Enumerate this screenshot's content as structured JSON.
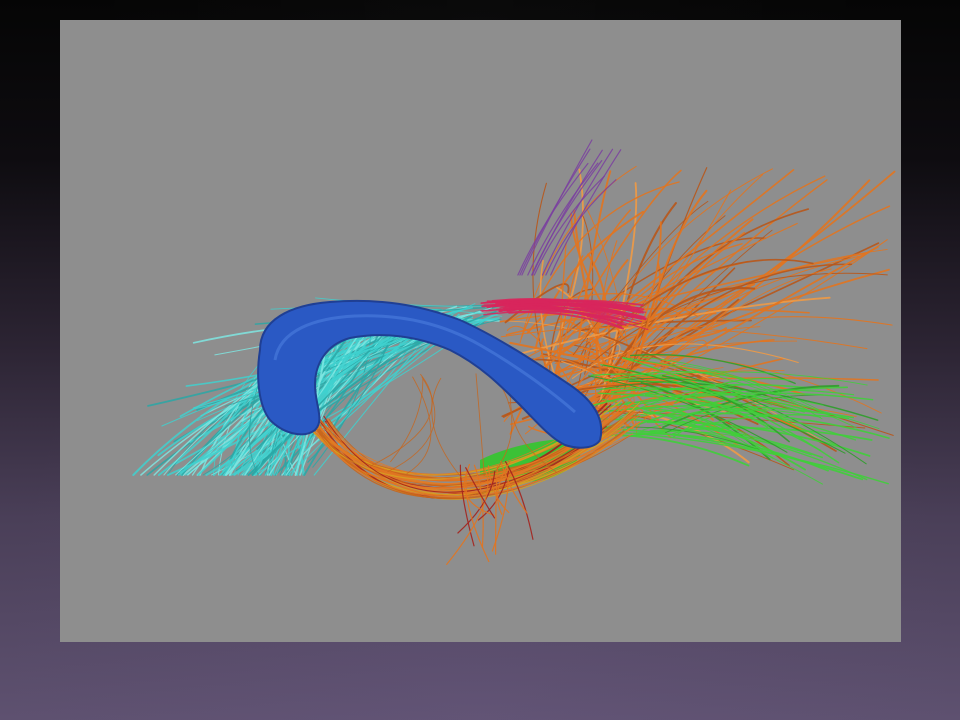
{
  "slide": {
    "background_top": "#050505",
    "background_bottom": "#5e5170"
  },
  "figure": {
    "kind": "tractography rendering",
    "backdrop_color": "#8e8e8e",
    "bundles": [
      {
        "name": "cyan-fibers",
        "color": "#3fd1cf"
      },
      {
        "name": "orange-fibers",
        "color": "#e2741f"
      },
      {
        "name": "magenta-fibers",
        "color": "#d8265c"
      },
      {
        "name": "green-fibers",
        "color": "#3fcf3a"
      },
      {
        "name": "blue-structure",
        "color": "#2a59c4"
      },
      {
        "name": "red-fibers",
        "color": "#a4221d"
      }
    ]
  }
}
